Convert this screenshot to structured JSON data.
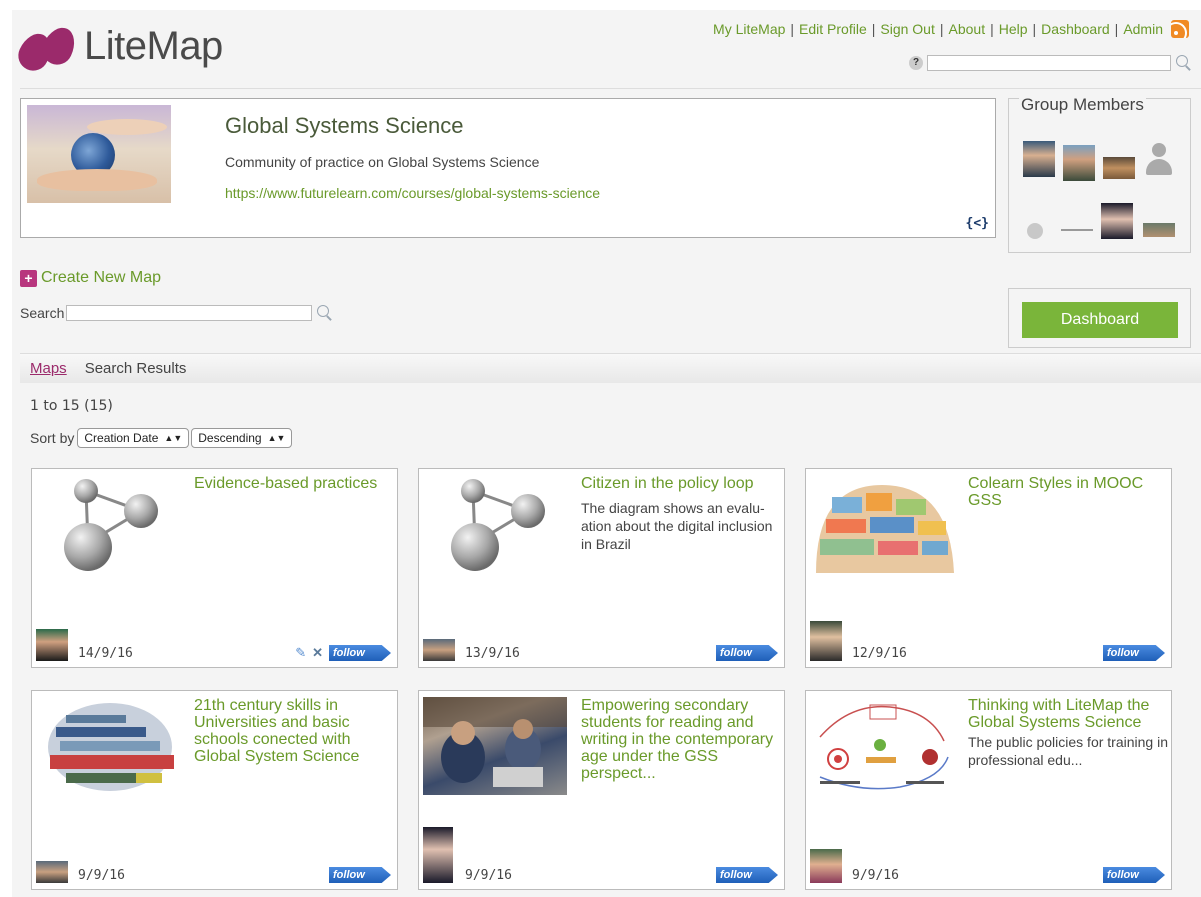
{
  "app": {
    "name": "LiteMap"
  },
  "toplinks": [
    "My LiteMap",
    "Edit Profile",
    "Sign Out",
    "About",
    "Help",
    "Dashboard",
    "Admin"
  ],
  "top_search": {
    "help_label": "?",
    "value": ""
  },
  "group": {
    "title": "Global Systems Science",
    "description": "Community of practice on Global Systems Science",
    "url": "https://www.futurelearn.com/courses/global-systems-science",
    "embed_icon": "{<}"
  },
  "members": {
    "title": "Group Members"
  },
  "create_label": "Create New Map",
  "search_label": "Search",
  "dashboard_label": "Dashboard",
  "tabs": {
    "maps": "Maps",
    "results": "Search Results"
  },
  "count_text": "1 to 15 (15)",
  "sort": {
    "label": "Sort by",
    "field": "Creation Date",
    "order": "Descending"
  },
  "follow_label": "follow",
  "cards": [
    {
      "title": "Evidence-based practices",
      "description": "",
      "date": "14/9/16"
    },
    {
      "title": "Citizen in the policy loop",
      "description": "The diagram shows an evalu-ation about the digital inclusion in Brazil",
      "date": "13/9/16"
    },
    {
      "title": "Colearn Styles in MOOC GSS",
      "description": "",
      "date": "12/9/16"
    },
    {
      "title": "21th century skills in Universities and basic schools conected with Global System Science",
      "description": "",
      "date": "9/9/16"
    },
    {
      "title": "Empowering secondary students for reading and writing in the contemporary age under the GSS perspect...",
      "description": "",
      "date": "9/9/16"
    },
    {
      "title": "Thinking with LiteMap the Global Systems Science",
      "description": "The public policies for training in professional edu...",
      "date": "9/9/16"
    }
  ]
}
